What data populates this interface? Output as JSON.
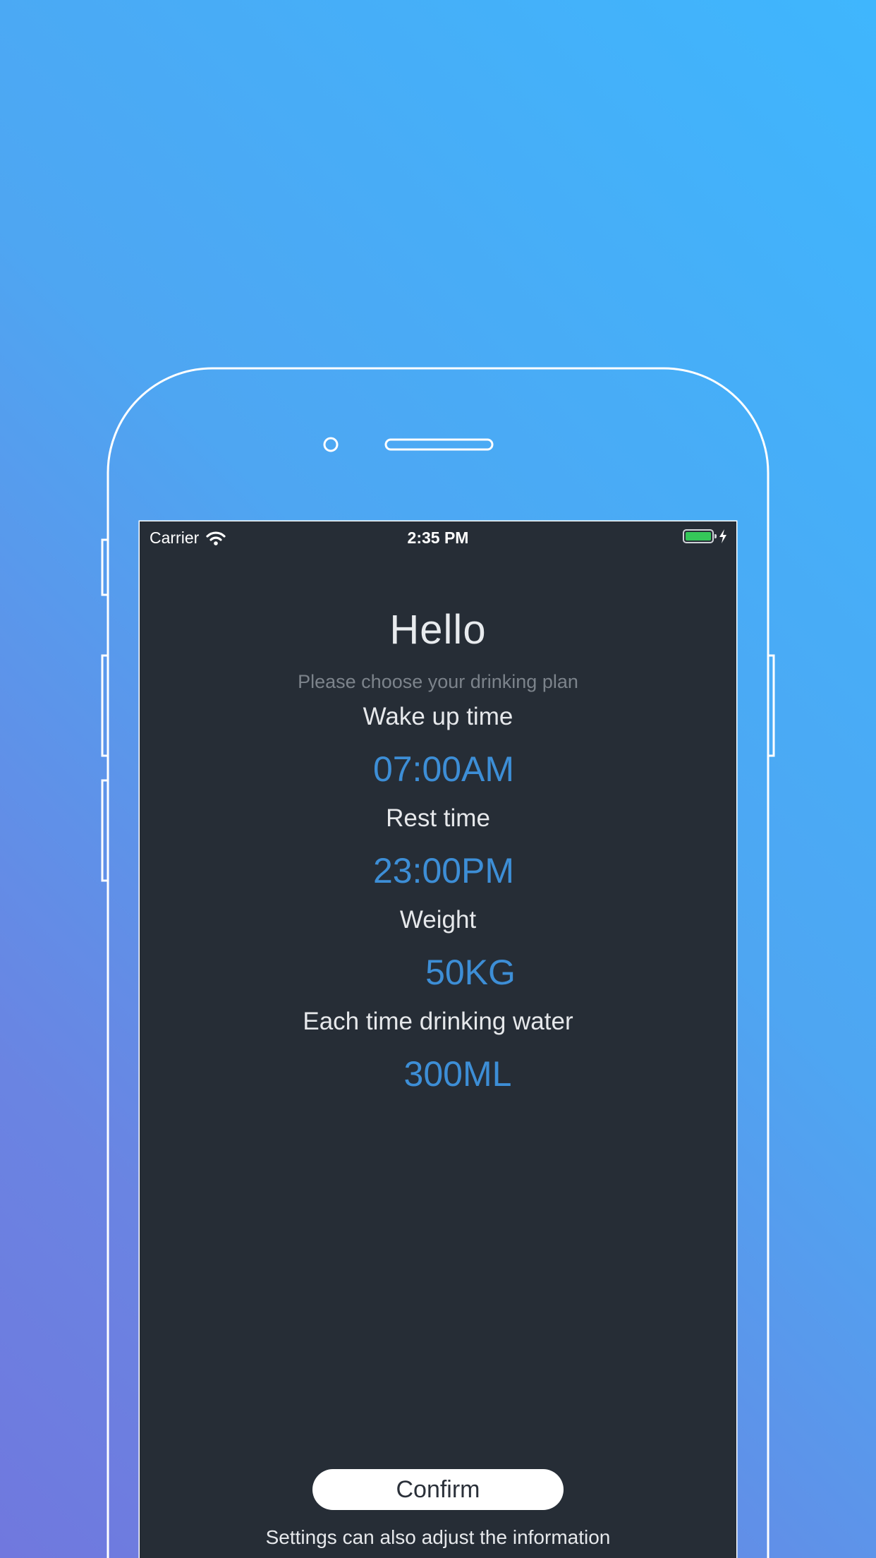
{
  "status_bar": {
    "carrier": "Carrier",
    "time": "2:35 PM"
  },
  "plan": {
    "title": "Hello",
    "subtitle": "Please choose your drinking plan",
    "wake_label": "Wake up time",
    "wake_value": "07:00AM",
    "rest_label": "Rest time",
    "rest_value": "23:00PM",
    "weight_label": "Weight",
    "weight_value": "50KG",
    "drink_label": "Each time drinking water",
    "drink_value": "300ML"
  },
  "actions": {
    "confirm_label": "Confirm",
    "footnote": "Settings can also adjust the information"
  },
  "colors": {
    "background_top": "#3fb6fd",
    "background_bottom": "#7078de",
    "screen_bg": "#262d36",
    "accent_value": "#3d8ed6",
    "battery": "#35c759"
  }
}
